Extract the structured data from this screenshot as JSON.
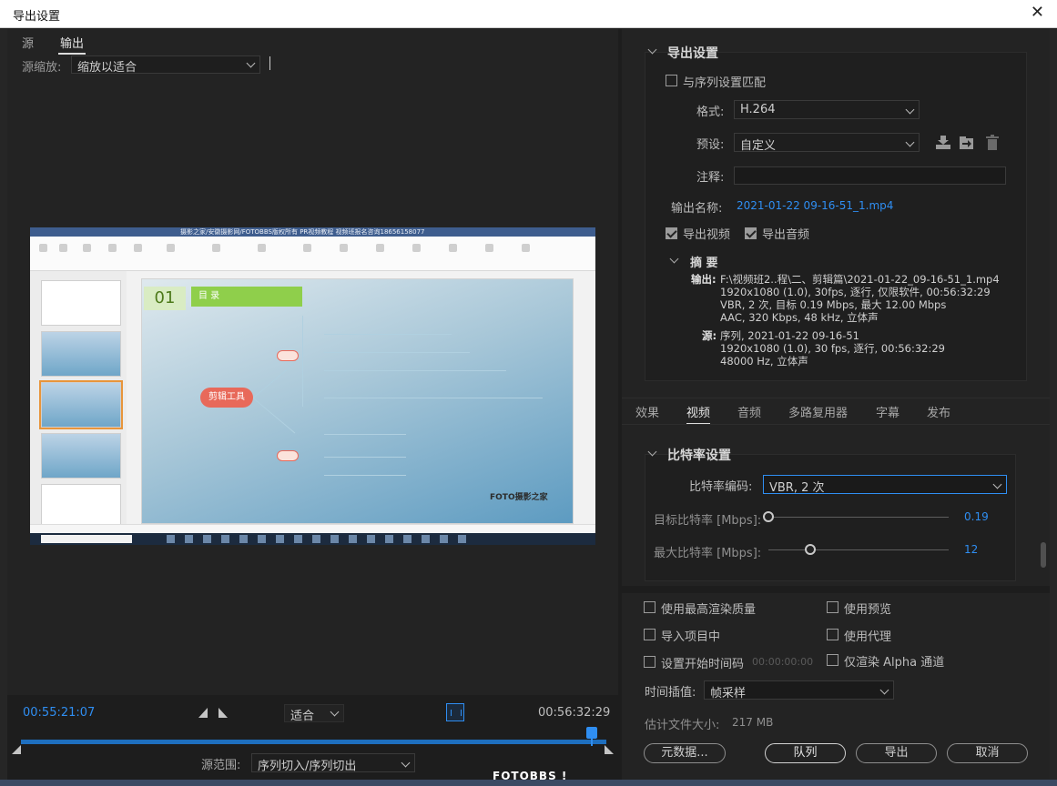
{
  "window": {
    "title": "导出设置",
    "close_glyph": "✕"
  },
  "left": {
    "tabs": [
      "源",
      "输出"
    ],
    "active_tab": "输出",
    "source_scale_label": "源缩放:",
    "source_scale_value": "缩放以适合",
    "preview": {
      "app_title": "摄影之家/安徽摄影网/FOTOBBS版权所有 PR视频教程 视频班报名咨询18656158077",
      "slide_number": "01",
      "slide_heading": "目 录",
      "central_node": "剪辑工具",
      "watermark": "FOTO摄影之家"
    },
    "timeline": {
      "current_time": "00:55:21:07",
      "fit_value": "适合",
      "end_time": "00:56:32:29",
      "progress": 0.97,
      "range_label": "源范围:",
      "range_value": "序列切入/序列切出"
    }
  },
  "export_settings": {
    "header": "导出设置",
    "match_sequence_label": "与序列设置匹配",
    "match_sequence_checked": false,
    "format_label": "格式:",
    "format_value": "H.264",
    "preset_label": "预设:",
    "preset_value": "自定义",
    "comment_label": "注释:",
    "comment_value": "",
    "output_name_label": "输出名称:",
    "output_name_value": "2021-01-22 09-16-51_1.mp4",
    "export_video_label": "导出视频",
    "export_video_checked": true,
    "export_audio_label": "导出音频",
    "export_audio_checked": true,
    "summary": {
      "header": "摘 要",
      "output_label": "输出:",
      "output_lines": [
        "F:\\视频班2..程\\二、剪辑篇\\2021-01-22_09-16-51_1.mp4",
        "1920x1080 (1.0), 30fps, 逐行, 仅限软件, 00:56:32:29",
        "VBR, 2 次, 目标 0.19 Mbps, 最大 12.00 Mbps",
        "AAC, 320 Kbps, 48  kHz, 立体声"
      ],
      "source_label": "源:",
      "source_lines": [
        "序列, 2021-01-22 09-16-51",
        "1920x1080 (1.0), 30 fps, 逐行, 00:56:32:29",
        "48000 Hz, 立体声"
      ]
    }
  },
  "tabs": [
    "效果",
    "视频",
    "音频",
    "多路复用器",
    "字幕",
    "发布"
  ],
  "active_tab": "视频",
  "bitrate": {
    "header": "比特率设置",
    "encoding_label": "比特率编码:",
    "encoding_value": "VBR, 2 次",
    "target_label": "目标比特率 [Mbps]:",
    "target_value": "0.19",
    "target_fraction": 0.0,
    "max_label": "最大比特率 [Mbps]:",
    "max_value": "12",
    "max_fraction": 0.2
  },
  "options": {
    "max_render_quality": "使用最高渲染质量",
    "use_previews": "使用预览",
    "import_into_project": "导入项目中",
    "use_proxies": "使用代理",
    "set_start_timecode": "设置开始时间码",
    "start_timecode_value": "00:00:00:00",
    "render_alpha_only": "仅渲染 Alpha 通道",
    "time_interpolation_label": "时间插值:",
    "time_interpolation_value": "帧采样",
    "est_size_label": "估计文件大小:",
    "est_size_value": "217 MB"
  },
  "buttons": {
    "metadata": "元数据...",
    "queue": "队列",
    "export": "导出",
    "cancel": "取消"
  },
  "footer_watermark": "FOTOBBS !"
}
